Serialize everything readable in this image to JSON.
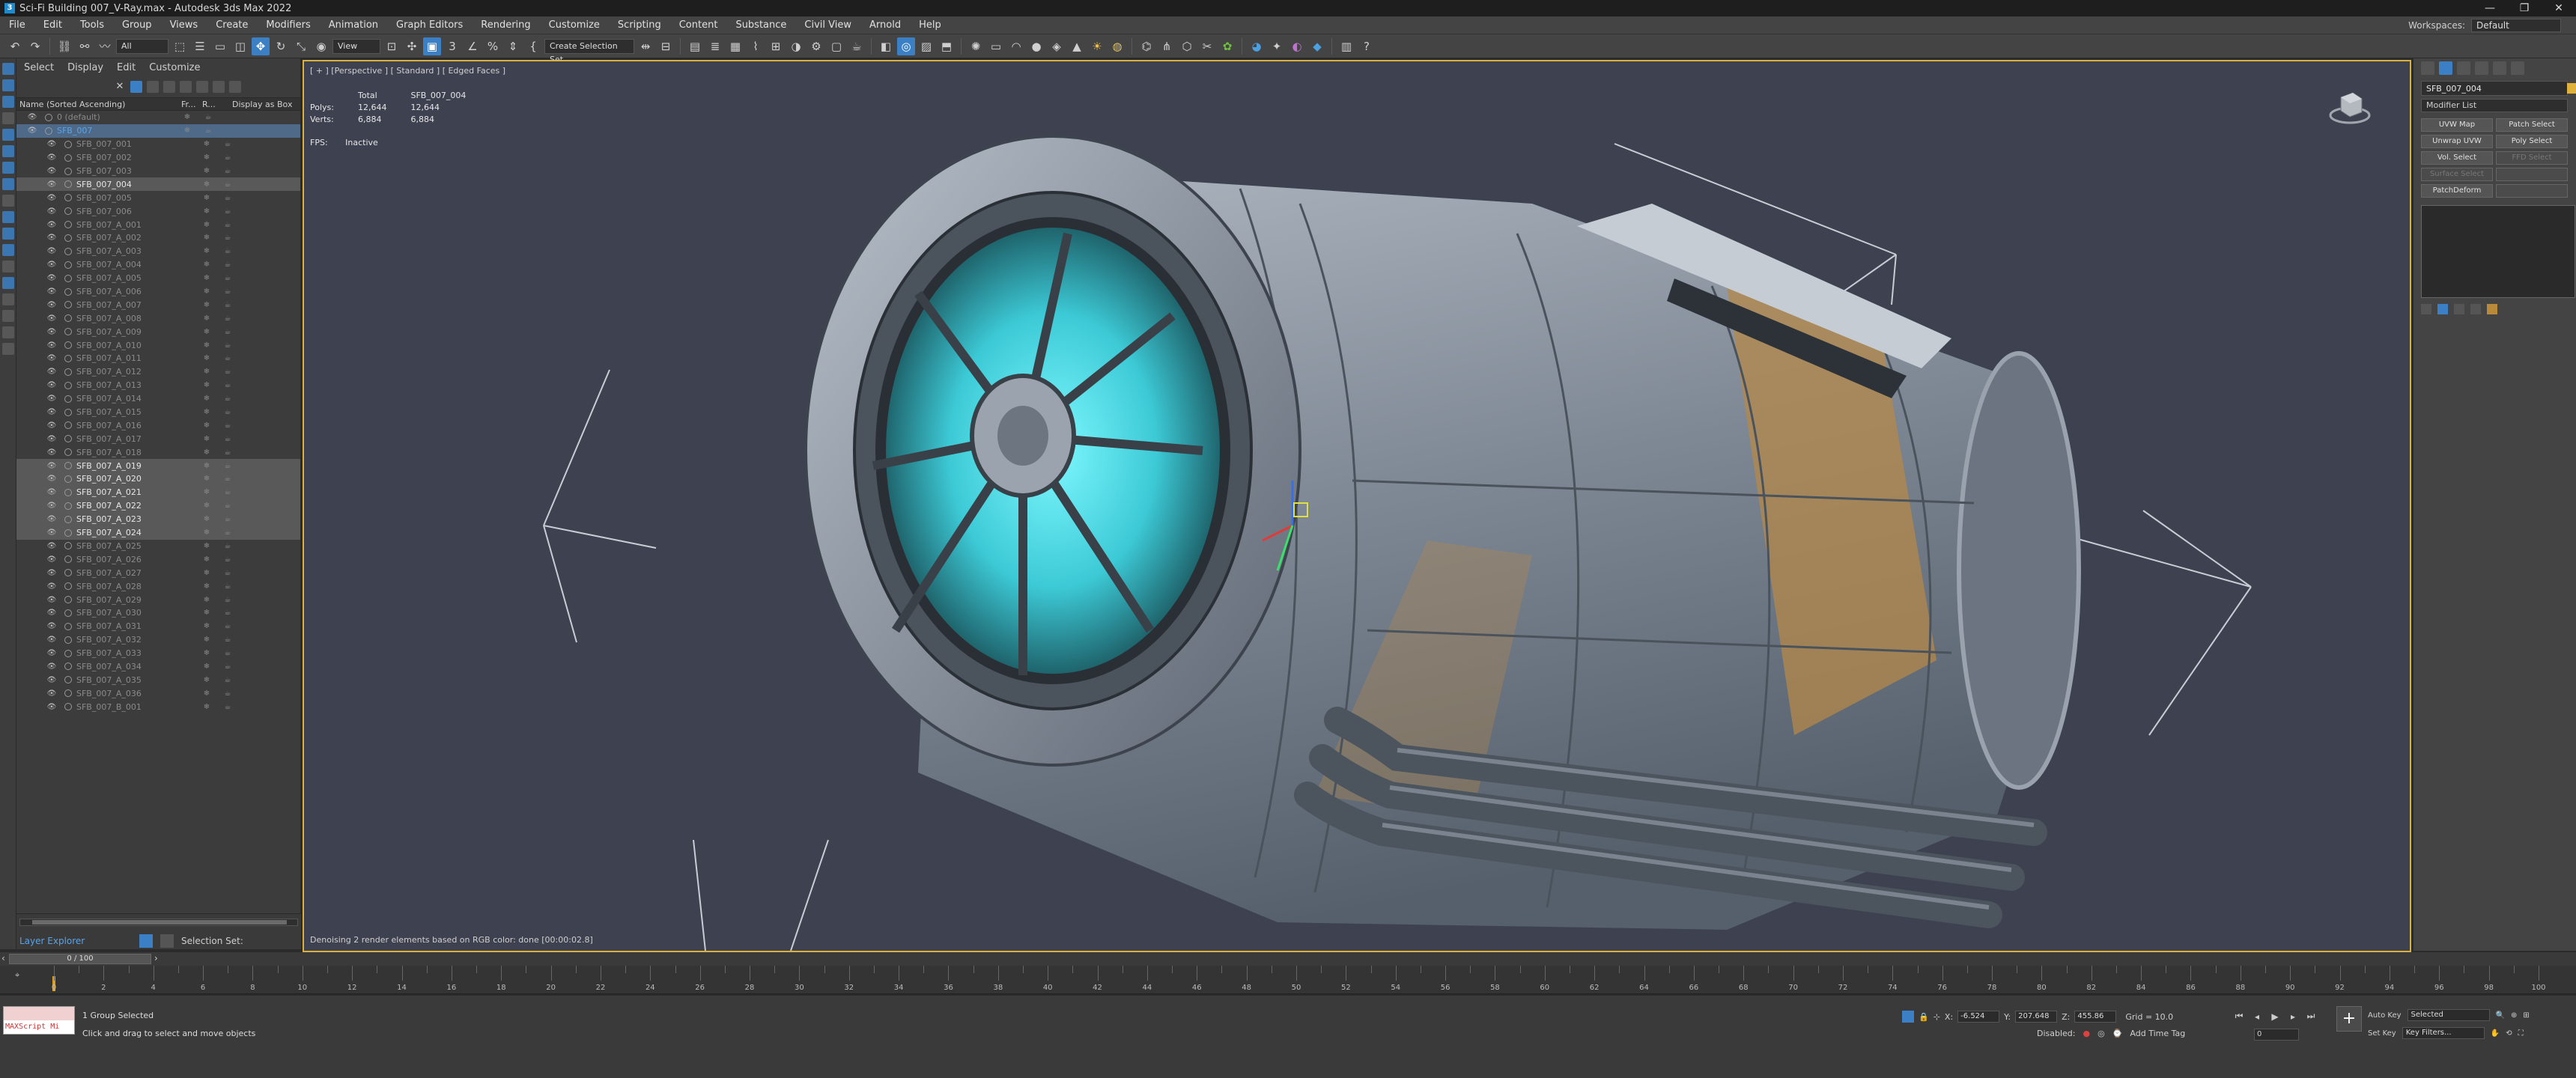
{
  "window": {
    "title": "Sci-Fi Building 007_V-Ray.max - Autodesk 3ds Max 2022",
    "controls": [
      "—",
      "❐",
      "✕"
    ]
  },
  "menu": {
    "items": [
      "File",
      "Edit",
      "Tools",
      "Group",
      "Views",
      "Create",
      "Modifiers",
      "Animation",
      "Graph Editors",
      "Rendering",
      "Customize",
      "Scripting",
      "Content",
      "Substance",
      "Civil View",
      "Arnold",
      "Help"
    ],
    "workspace_label": "Workspaces:",
    "workspace_value": "Default"
  },
  "toolbar": {
    "filter_value": "All",
    "ref_coord_value": "View",
    "selection_set_value": "Create Selection Set"
  },
  "explorer": {
    "menu": [
      "Select",
      "Display",
      "Edit",
      "Customize"
    ],
    "header": {
      "name": "Name (Sorted Ascending)",
      "col1": "Fr...",
      "col2": "R...",
      "col3": "Display as Box"
    },
    "rows": [
      {
        "label": "0 (default)",
        "style": "layer"
      },
      {
        "label": "SFB_007",
        "style": "group"
      },
      {
        "label": "SFB_007_001",
        "style": ""
      },
      {
        "label": "SFB_007_002",
        "style": ""
      },
      {
        "label": "SFB_007_003",
        "style": ""
      },
      {
        "label": "SFB_007_004",
        "style": "hl"
      },
      {
        "label": "SFB_007_005",
        "style": ""
      },
      {
        "label": "SFB_007_006",
        "style": ""
      },
      {
        "label": "SFB_007_A_001",
        "style": ""
      },
      {
        "label": "SFB_007_A_002",
        "style": ""
      },
      {
        "label": "SFB_007_A_003",
        "style": ""
      },
      {
        "label": "SFB_007_A_004",
        "style": ""
      },
      {
        "label": "SFB_007_A_005",
        "style": ""
      },
      {
        "label": "SFB_007_A_006",
        "style": ""
      },
      {
        "label": "SFB_007_A_007",
        "style": ""
      },
      {
        "label": "SFB_007_A_008",
        "style": ""
      },
      {
        "label": "SFB_007_A_009",
        "style": ""
      },
      {
        "label": "SFB_007_A_010",
        "style": ""
      },
      {
        "label": "SFB_007_A_011",
        "style": ""
      },
      {
        "label": "SFB_007_A_012",
        "style": ""
      },
      {
        "label": "SFB_007_A_013",
        "style": ""
      },
      {
        "label": "SFB_007_A_014",
        "style": ""
      },
      {
        "label": "SFB_007_A_015",
        "style": ""
      },
      {
        "label": "SFB_007_A_016",
        "style": ""
      },
      {
        "label": "SFB_007_A_017",
        "style": ""
      },
      {
        "label": "SFB_007_A_018",
        "style": ""
      },
      {
        "label": "SFB_007_A_019",
        "style": "hl"
      },
      {
        "label": "SFB_007_A_020",
        "style": "hl"
      },
      {
        "label": "SFB_007_A_021",
        "style": "hl"
      },
      {
        "label": "SFB_007_A_022",
        "style": "hl"
      },
      {
        "label": "SFB_007_A_023",
        "style": "hl"
      },
      {
        "label": "SFB_007_A_024",
        "style": "hl"
      },
      {
        "label": "SFB_007_A_025",
        "style": ""
      },
      {
        "label": "SFB_007_A_026",
        "style": ""
      },
      {
        "label": "SFB_007_A_027",
        "style": ""
      },
      {
        "label": "SFB_007_A_028",
        "style": ""
      },
      {
        "label": "SFB_007_A_029",
        "style": ""
      },
      {
        "label": "SFB_007_A_030",
        "style": ""
      },
      {
        "label": "SFB_007_A_031",
        "style": ""
      },
      {
        "label": "SFB_007_A_032",
        "style": ""
      },
      {
        "label": "SFB_007_A_033",
        "style": ""
      },
      {
        "label": "SFB_007_A_034",
        "style": ""
      },
      {
        "label": "SFB_007_A_035",
        "style": ""
      },
      {
        "label": "SFB_007_A_036",
        "style": ""
      },
      {
        "label": "SFB_007_B_001",
        "style": ""
      }
    ],
    "footer": {
      "layer_label": "Layer Explorer",
      "selection_set_label": "Selection Set:"
    }
  },
  "viewport": {
    "label": "[ + ] [Perspective ] [ Standard ] [ Edged Faces ]",
    "stats": {
      "total_label": "Total",
      "object_label": "SFB_007_004",
      "polys_label": "Polys:",
      "polys_total": "12,644",
      "polys_object": "12,644",
      "verts_label": "Verts:",
      "verts_total": "6,884",
      "verts_object": "6,884"
    },
    "fps_label": "FPS:",
    "fps_value": "Inactive",
    "status": "Denoising 2 render elements based on RGB color: done [00:00:02.8]",
    "colors": {
      "background": "#3e4250",
      "border": "#d9b13c",
      "hull": "#8d97a3",
      "glow": "#48e0e8",
      "stripe": "#b4884a"
    }
  },
  "command_panel": {
    "object_name": "SFB_007_004",
    "modifier_list": "Modifier List",
    "modifier_buttons": [
      {
        "label": "UVW Map",
        "dim": false
      },
      {
        "label": "Patch Select",
        "dim": false
      },
      {
        "label": "Unwrap UVW",
        "dim": false
      },
      {
        "label": "Poly Select",
        "dim": false
      },
      {
        "label": "Vol. Select",
        "dim": false
      },
      {
        "label": "FFD Select",
        "dim": true
      },
      {
        "label": "Surface Select",
        "dim": true
      },
      {
        "label": "",
        "dim": true
      },
      {
        "label": "PatchDeform",
        "dim": false
      },
      {
        "label": "",
        "dim": true
      }
    ]
  },
  "timeline": {
    "frame_display": "0 / 100",
    "ticks": [
      0,
      2,
      4,
      6,
      8,
      10,
      12,
      14,
      16,
      18,
      20,
      22,
      24,
      26,
      28,
      30,
      32,
      34,
      36,
      38,
      40,
      42,
      44,
      46,
      48,
      50,
      52,
      54,
      56,
      58,
      60,
      62,
      64,
      66,
      68,
      70,
      72,
      74,
      76,
      78,
      80,
      82,
      84,
      86,
      88,
      90,
      92,
      94,
      96,
      98,
      100
    ],
    "current_frame": 0,
    "total_frames": 100
  },
  "status": {
    "maxscript_label": "MAXScript Mi",
    "selection": "1 Group Selected",
    "prompt": "Click and drag to select and move objects",
    "x_label": "X:",
    "x_value": "-6.524",
    "y_label": "Y:",
    "y_value": "207.648",
    "z_label": "Z:",
    "z_value": "455.86",
    "grid": "Grid = 10.0",
    "disabled_label": "Disabled:",
    "add_time_tag": "Add Time Tag",
    "auto_key": "Auto Key",
    "auto_key_value": "Selected",
    "set_key": "Set Key",
    "key_filters": "Key Filters...",
    "frame_field": "0"
  }
}
